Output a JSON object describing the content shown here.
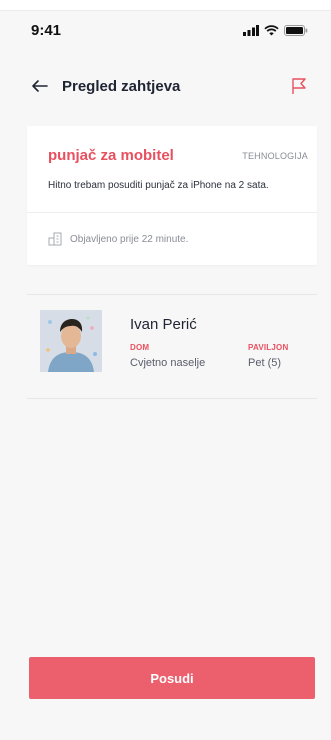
{
  "status_bar": {
    "time": "9:41"
  },
  "header": {
    "title": "Pregled zahtjeva"
  },
  "request": {
    "item": "punjač za mobitel",
    "category": "TEHNOLOGIJA",
    "description": "Hitno trebam posuditi punjač za iPhone na 2 sata.",
    "posted": "Objavljeno prije 22 minute."
  },
  "requester": {
    "name": "Ivan Perić",
    "dom_label": "DOM",
    "dom_value": "Cvjetno naselje",
    "pavilion_label": "PAVILJON",
    "pavilion_value": "Pet (5)"
  },
  "action": {
    "button_label": "Posudi"
  },
  "colors": {
    "accent": "#e8505f",
    "button": "#ec5f6d",
    "background": "#f7f7f8"
  },
  "icons": [
    "signal-icon",
    "wifi-icon",
    "battery-icon",
    "back-arrow-icon",
    "flag-icon",
    "building-icon"
  ]
}
